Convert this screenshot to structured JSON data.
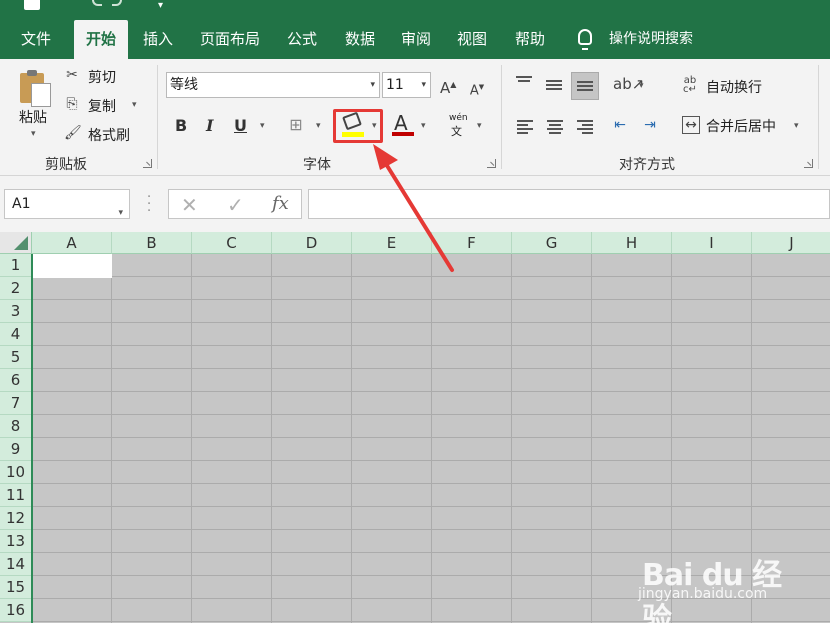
{
  "menu_tabs": [
    "文件",
    "开始",
    "插入",
    "页面布局",
    "公式",
    "数据",
    "审阅",
    "视图",
    "帮助"
  ],
  "tell_me": "操作说明搜索",
  "clipboard": {
    "paste": "粘贴",
    "cut": "剪切",
    "copy": "复制",
    "format_painter": "格式刷",
    "group_label": "剪贴板"
  },
  "font": {
    "font_name": "等线",
    "font_size": "11",
    "bold": "B",
    "italic": "I",
    "underline": "U",
    "phonetic": "wén",
    "phonetic_sub": "文",
    "color_letter": "A",
    "group_label": "字体",
    "fill_color": "#ffff00",
    "font_color": "#c00000"
  },
  "alignment": {
    "wrap_text": "自动换行",
    "merge_center": "合并后居中",
    "group_label": "对齐方式"
  },
  "formula_bar": {
    "name_box": "A1",
    "fx": "fx"
  },
  "grid": {
    "columns": [
      "A",
      "B",
      "C",
      "D",
      "E",
      "F",
      "G",
      "H",
      "I",
      "J"
    ],
    "rows": [
      "1",
      "2",
      "3",
      "4",
      "5",
      "6",
      "7",
      "8",
      "9",
      "10",
      "11",
      "12",
      "13",
      "14",
      "15",
      "16"
    ]
  },
  "watermark": {
    "brand": "Bai du 经验",
    "url": "jingyan.baidu.com"
  },
  "colors": {
    "excel_green": "#217346",
    "highlight_red": "#e53935",
    "grid_gray": "#c6c6c6"
  }
}
